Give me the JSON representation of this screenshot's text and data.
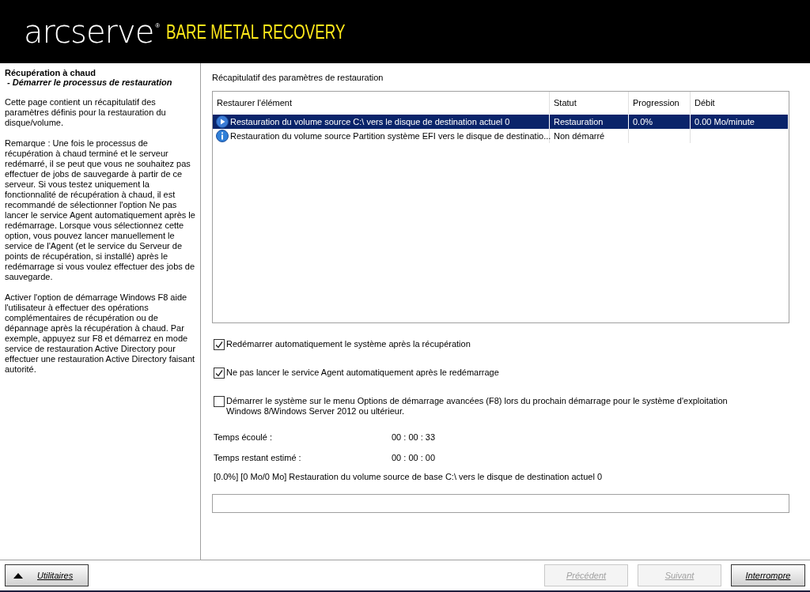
{
  "header": {
    "brand": "arcserve",
    "registered": "®",
    "product": "BARE METAL RECOVERY"
  },
  "sidebar": {
    "title": "Récupération à chaud",
    "subtitle": " - Démarrer le processus de restauration",
    "paragraphs": [
      "Cette page contient un récapitulatif des paramètres définis pour la restauration du disque/volume.",
      "Remarque : Une fois le processus de récupération à chaud terminé et le serveur redémarré, il se peut que vous ne souhaitez pas effectuer de jobs de sauvegarde à partir de ce serveur. Si vous testez uniquement la fonctionnalité de récupération à chaud, il est recommandé de sélectionner l'option Ne pas lancer le service Agent automatiquement après le redémarrage. Lorsque vous sélectionnez cette option, vous pouvez lancer manuellement le service de l'Agent (et le service du Serveur de points de récupération, si installé) après le redémarrage si vous voulez effectuer des jobs de sauvegarde.",
      "Activer l'option de démarrage Windows F8 aide l'utilisateur à effectuer des opérations complémentaires de récupération ou de dépannage après la récupération à chaud. Par exemple, appuyez sur F8 et démarrez en mode service de restauration Active Directory pour effectuer une restauration Active Directory faisant autorité."
    ]
  },
  "summary_title": "Récapitulatif des paramètres de restauration",
  "table": {
    "columns": [
      "Restaurer l'élément",
      "Statut",
      "Progression",
      "Débit"
    ],
    "rows": [
      {
        "kind": "running",
        "selected": true,
        "cells": [
          "Restauration du volume source C:\\ vers le disque de destination actuel 0",
          "Restauration",
          "0.0%",
          "0.00 Mo/minute"
        ]
      },
      {
        "kind": "pending",
        "selected": false,
        "cells": [
          "Restauration du volume source Partition système EFI vers le disque de destinatio...",
          "Non démarré",
          "",
          ""
        ]
      }
    ]
  },
  "options": [
    {
      "label": "Redémarrer automatiquement le système après la récupération",
      "checked": true
    },
    {
      "label": "Ne pas lancer le service Agent automatiquement après le redémarrage",
      "checked": true
    },
    {
      "label": "Démarrer le système sur le menu Options de démarrage avancées (F8) lors du prochain démarrage pour le système d'exploitation Windows 8/Windows Server 2012 ou ultérieur.",
      "checked": false
    }
  ],
  "times": [
    {
      "label": "Temps écoulé :",
      "value": "00 : 00 : 33"
    },
    {
      "label": "Temps restant estimé :",
      "value": "00 : 00 : 00"
    }
  ],
  "status_line": "[0.0%] [0 Mo/0 Mo] Restauration du volume source de base C:\\ vers le disque de destination actuel 0",
  "progress": {
    "level": 0
  },
  "buttons": [
    {
      "label": "Utilitaires",
      "disabled": false,
      "kind": "menu"
    },
    {
      "label": "Précédent",
      "disabled": true,
      "kind": "plain"
    },
    {
      "label": "Suivant",
      "disabled": true,
      "kind": "plain"
    },
    {
      "label": "Interrompre",
      "disabled": false,
      "kind": "plain"
    }
  ]
}
